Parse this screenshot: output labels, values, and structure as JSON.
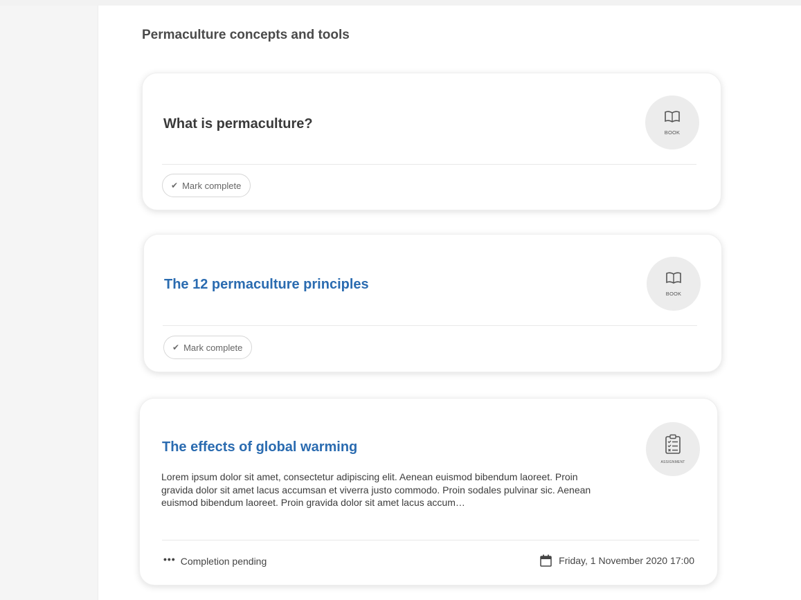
{
  "section": {
    "title": "Permaculture concepts and tools"
  },
  "cards": [
    {
      "title": "What is permaculture?",
      "badge": "BOOK",
      "action": "Mark complete"
    },
    {
      "title": "The 12 permaculture principles",
      "badge": "BOOK",
      "action": "Mark complete"
    },
    {
      "title": "The effects of global warming",
      "badge": "ASSIGNMENT",
      "description": "Lorem ipsum dolor sit amet, consectetur adipiscing elit. Aenean euismod bibendum laoreet. Proin gravida dolor sit amet lacus accumsan et viverra justo commodo. Proin sodales pulvinar sic. Aenean euismod bibendum laoreet. Proin gravida dolor sit amet lacus accum…",
      "status": "Completion pending",
      "due": "Friday, 1 November 2020 17:00"
    }
  ],
  "colors": {
    "link": "#2a6bb0",
    "title_dark": "#3a3a3a",
    "badge_bg": "#ececec"
  },
  "icons": {
    "book": "book-icon",
    "assignment": "clipboard-checklist-icon",
    "check": "check-icon",
    "calendar": "calendar-icon",
    "more": "more-dots-icon"
  }
}
